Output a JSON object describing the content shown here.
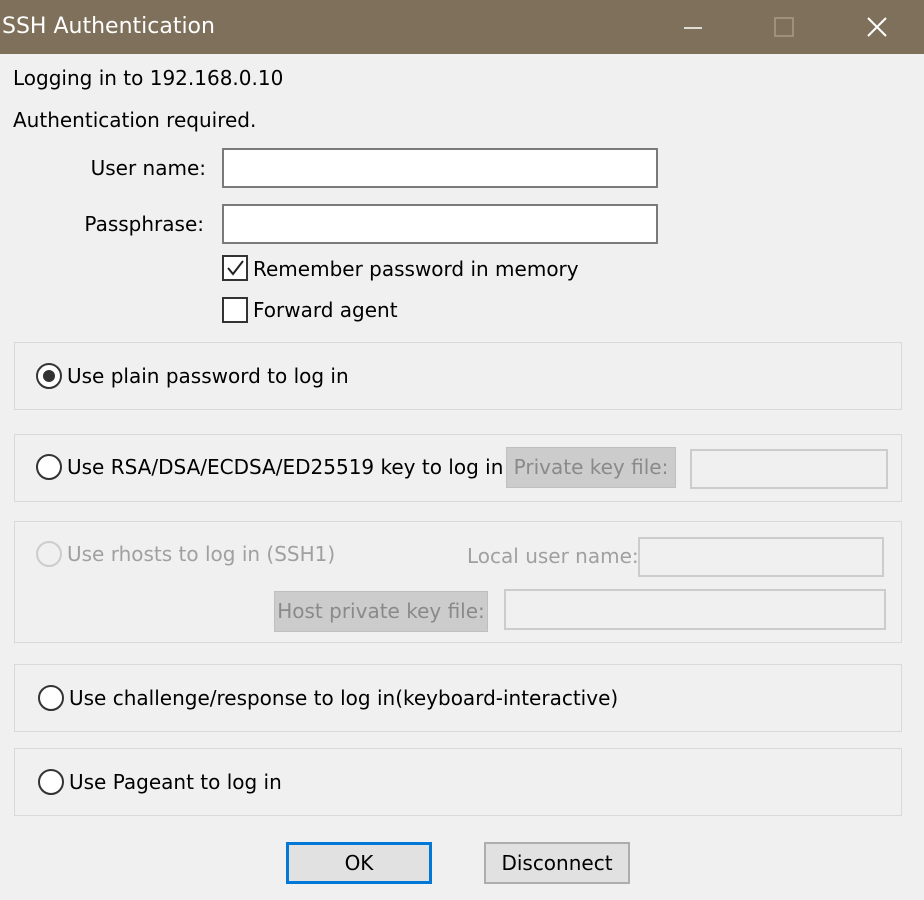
{
  "window": {
    "title": "SSH Authentication",
    "controls": {
      "minimize": "minimize-icon",
      "maximize": "maximize-icon",
      "close": "close-icon"
    }
  },
  "header": {
    "logging_in": "Logging in to 192.168.0.10",
    "auth_required": "Authentication required."
  },
  "form": {
    "username_label": "User name:",
    "username_value": "",
    "passphrase_label": "Passphrase:",
    "passphrase_value": "",
    "remember_label": "Remember password in memory",
    "remember_checked": true,
    "forward_label": "Forward agent",
    "forward_checked": false
  },
  "methods": {
    "plain": {
      "label": "Use plain password to log in",
      "selected": true
    },
    "key": {
      "label": "Use RSA/DSA/ECDSA/ED25519 key to log in",
      "selected": false,
      "private_key_button": "Private key file:",
      "private_key_value": ""
    },
    "rhosts": {
      "label": "Use rhosts to log in (SSH1)",
      "selected": false,
      "disabled": true,
      "local_user_label": "Local user name:",
      "local_user_value": "",
      "host_key_button": "Host private key file:",
      "host_key_value": ""
    },
    "challenge": {
      "label": "Use challenge/response to log in(keyboard-interactive)",
      "selected": false
    },
    "pageant": {
      "label": "Use Pageant to log in",
      "selected": false
    }
  },
  "buttons": {
    "ok": "OK",
    "disconnect": "Disconnect"
  },
  "colors": {
    "titlebar": "#7e705a",
    "dialog_bg": "#f0f0f0",
    "default_button_border": "#0078d7"
  }
}
